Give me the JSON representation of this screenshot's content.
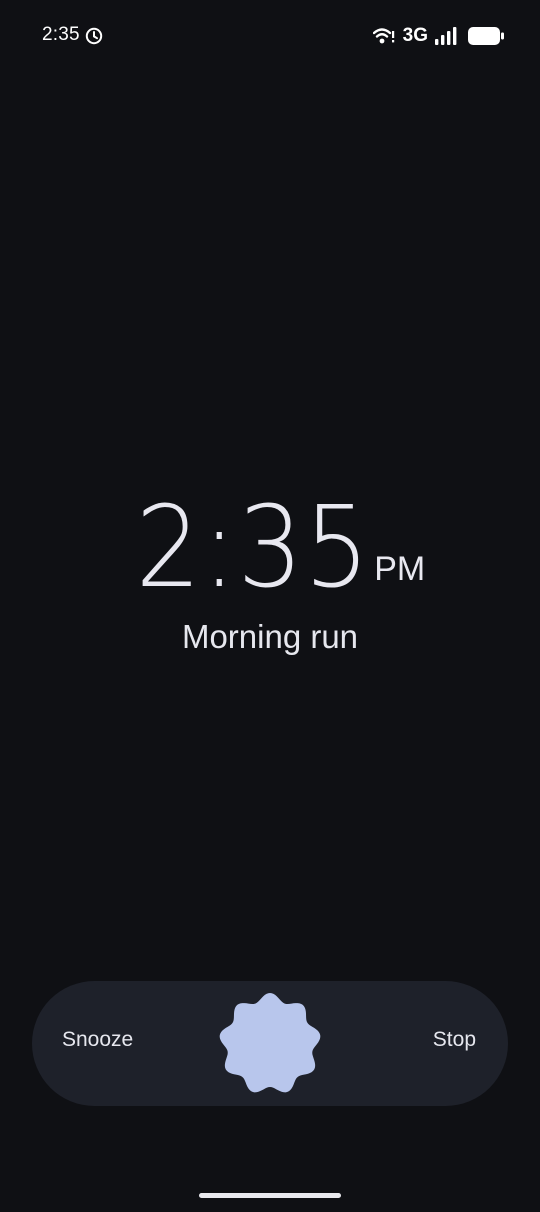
{
  "status_bar": {
    "time": "2:35",
    "network": "3G",
    "icons": [
      "alarm-clock-icon",
      "wifi-icon",
      "signal-icon",
      "battery-icon"
    ]
  },
  "alarm": {
    "time": "2:35",
    "ampm": "PM",
    "label": "Morning run"
  },
  "actions": {
    "snooze_label": "Snooze",
    "stop_label": "Stop",
    "handle_icon": "dismiss-handle-icon"
  },
  "colors": {
    "background": "#0f1014",
    "track": "#1e212a",
    "handle": "#b8c6ec",
    "text": "#e6e7ee"
  }
}
